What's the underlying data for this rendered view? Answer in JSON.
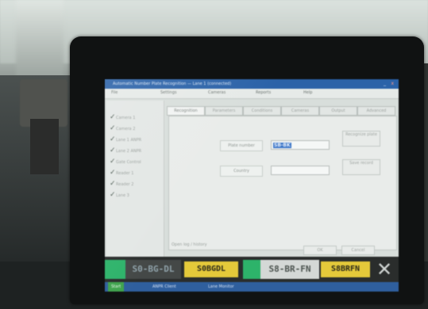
{
  "app": {
    "title": "Automatic Number Plate Recognition — Lane 1 (connected)",
    "menu": [
      "File",
      "Settings",
      "Cameras",
      "Reports",
      "Help"
    ],
    "sidebar": [
      "Camera 1",
      "Camera 2",
      "Lane 1 ANPR",
      "Lane 2 ANPR",
      "Gate Control",
      "Reader 1",
      "Reader 2",
      "Lane 3"
    ],
    "tabs": [
      "Recognition",
      "Parameters",
      "Conditions",
      "Cameras",
      "Output",
      "Advanced"
    ],
    "fields": {
      "field1_label": "Plate number",
      "field1_value": "SB-BK",
      "field2_label": "Country",
      "field2_value": ""
    },
    "buttons": {
      "right1": "Recognize plate",
      "right2": "Save record",
      "bottom_left": "Open log / history",
      "bottom_ok": "OK",
      "bottom_cancel": "Cancel"
    },
    "status_bar": {
      "plate1": "S0-BG-DL",
      "plate2": "S0BGDL",
      "plate3": "S8-BR-FN",
      "plate4": "S8BRFN",
      "close_symbol": "✕"
    },
    "taskbar": {
      "start": "Start",
      "item1": "ANPR Client",
      "item2": "Lane Monitor"
    }
  },
  "colors": {
    "plate_yellow": "#e4c93a",
    "green": "#2db36a",
    "titlebar_blue": "#2b62a8"
  }
}
